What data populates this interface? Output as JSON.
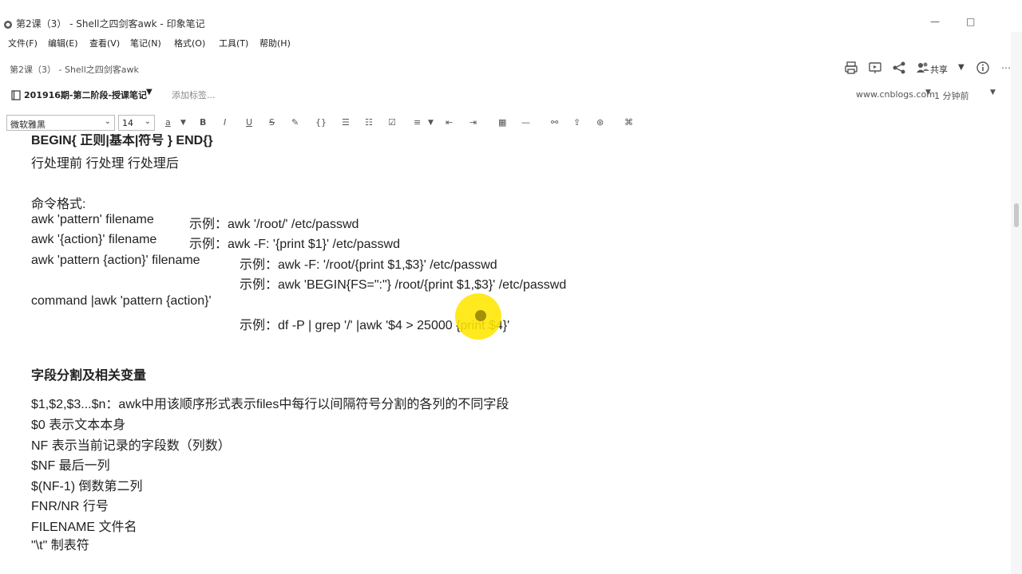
{
  "window": {
    "title": "第2课（3） - Shell之四剑客awk - 印象笔记",
    "controls": [
      "—",
      "□"
    ]
  },
  "menu": [
    "文件(F)",
    "编辑(E)",
    "查看(V)",
    "笔记(N)",
    "格式(O)",
    "工具(T)",
    "帮助(H)"
  ],
  "note_header": {
    "breadcrumb": "第2课（3） - Shell之四剑客awk",
    "share_label": "共享",
    "notebook": "201916期-第二阶段-授课笔记",
    "add_tag": "添加标签...",
    "source_url": "www.cnblogs.com",
    "updated": "1 分钟前"
  },
  "toolbar": {
    "font": "微软雅黑",
    "size": "14",
    "icons": [
      "font-color-icon",
      "bold-icon",
      "italic-icon",
      "underline-icon",
      "strikethrough-icon",
      "highlight-icon",
      "code-icon",
      "bullet-list-icon",
      "numbered-list-icon",
      "checkbox-icon",
      "align-icon",
      "outdent-icon",
      "indent-icon",
      "table-icon",
      "divider-icon",
      "link-icon",
      "upload-icon",
      "encrypt-icon",
      "more-icon"
    ]
  },
  "content": {
    "lines": [
      "BEGIN{ 正则|基本|符号 } END{}",
      "行处理前 行处理 行处理后",
      "命令格式:",
      "awk 'pattern' filename",
      "示例：awk '/root/' /etc/passwd",
      "awk '{action}' filename",
      "示例：awk -F: '{print $1}' /etc/passwd",
      "awk 'pattern {action}' filename",
      "示例：awk -F: '/root/{print $1,$3}' /etc/passwd",
      "示例：awk 'BEGIN{FS=\":\"} /root/{print $1,$3}' /etc/passwd",
      "command |awk 'pattern {action}'",
      "示例：df -P | grep '/' |awk '$4 > 25000 {print $4}'",
      "字段分割及相关变量",
      "$1,$2,$3...$n：awk中用该顺序形式表示files中每行以间隔符号分割的各列的不同字段",
      "$0 表示文本本身",
      "NF 表示当前记录的字段数（列数）",
      "$NF 最后一列",
      "$(NF-1) 倒数第二列",
      "FNR/NR 行号",
      "FILENAME 文件名",
      "\"\\t\" 制表符"
    ]
  },
  "cursor_highlight_color": "#ffe600"
}
